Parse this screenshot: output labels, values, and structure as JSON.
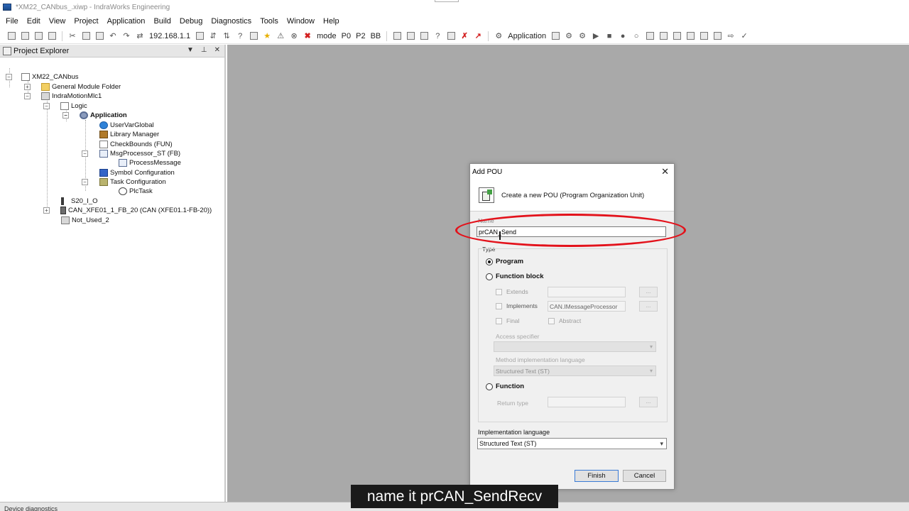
{
  "window": {
    "title": "*XM22_CANbus_.xiwp - IndraWorks Engineering"
  },
  "menu": [
    "File",
    "Edit",
    "View",
    "Project",
    "Application",
    "Build",
    "Debug",
    "Diagnostics",
    "Tools",
    "Window",
    "Help"
  ],
  "toolbar": {
    "ip": "192.168.1.1",
    "mode_label": "mode",
    "p0": "P0",
    "p2": "P2",
    "bb": "BB",
    "application_label": "Application"
  },
  "explorer": {
    "title": "Project Explorer",
    "tree": {
      "root": "XM22_CANbus",
      "general_module_folder": "General Module Folder",
      "device": "IndraMotionMlc1",
      "logic": "Logic",
      "application": "Application",
      "user_var_global": "UserVarGlobal",
      "library_manager": "Library Manager",
      "check_bounds": "CheckBounds (FUN)",
      "msg_processor": "MsgProcessor_ST (FB)",
      "process_message": "ProcessMessage",
      "symbol_configuration": "Symbol Configuration",
      "task_configuration": "Task Configuration",
      "plc_task": "PlcTask",
      "s20_io": "S20_I_O",
      "can_xfe": "CAN_XFE01_1_FB_20 (CAN (XFE01.1-FB-20))",
      "not_used": "Not_Used_2"
    }
  },
  "bottom_panel": {
    "tab_label": "Device diagnostics"
  },
  "dialog": {
    "title": "Add POU",
    "header_text": "Create a new POU (Program Organization Unit)",
    "name_label": "Name",
    "name_value": "prCAN_Send",
    "type_label": "Type",
    "program_label": "Program",
    "function_block_label": "Function block",
    "extends_label": "Extends",
    "implements_label": "Implements",
    "implements_value": "CAN.IMessageProcessor",
    "final_label": "Final",
    "abstract_label": "Abstract",
    "access_specifier_label": "Access specifier",
    "method_impl_lang_label": "Method implementation language",
    "method_impl_lang_value": "Structured Text (ST)",
    "function_label": "Function",
    "return_type_label": "Return type",
    "impl_lang_label": "Implementation language",
    "impl_lang_value": "Structured Text (ST)",
    "finish_label": "Finish",
    "cancel_label": "Cancel",
    "ellipsis": "...",
    "selected_type": "Program"
  },
  "caption": {
    "text": "name it prCAN_SendRecv"
  },
  "colors": {
    "workspace": "#a9a9a9",
    "highlight_ellipse": "#e3121b",
    "caption_bg": "#1a1a1a"
  }
}
